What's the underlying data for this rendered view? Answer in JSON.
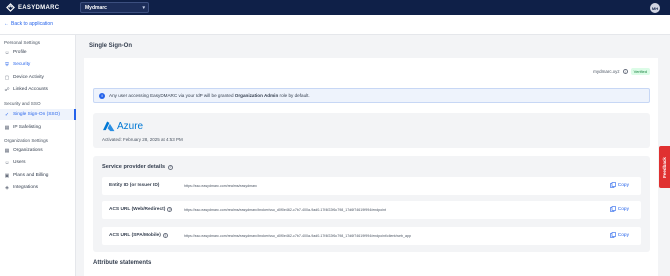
{
  "header": {
    "brand": "EASYDMARC",
    "org_name": "Mydmarc",
    "avatar_initials": "MH"
  },
  "nav": {
    "back_label": "Back to application"
  },
  "sidebar": {
    "personal_heading": "Personal Settings",
    "personal_items": [
      {
        "label": "Profile",
        "icon": "user-icon"
      },
      {
        "label": "Security",
        "icon": "shield-icon",
        "selected": true
      }
    ],
    "personal_items_2": [
      {
        "label": "Device Activity",
        "icon": "device-icon"
      },
      {
        "label": "Linked Accounts",
        "icon": "link-icon"
      }
    ],
    "security_heading": "Security and SSO",
    "security_items": [
      {
        "label": "Single Sign-On (SSO)",
        "icon": "shield-check-icon",
        "active": true
      },
      {
        "label": "IP Safelisting",
        "icon": "network-icon"
      }
    ],
    "org_heading": "Organization Settings",
    "org_items": [
      {
        "label": "Organizations",
        "icon": "building-icon"
      },
      {
        "label": "Users",
        "icon": "users-icon"
      },
      {
        "label": "Plans and Billing",
        "icon": "card-icon"
      },
      {
        "label": "Integrations",
        "icon": "puzzle-icon"
      }
    ]
  },
  "main": {
    "page_title": "Single Sign-On",
    "domain": "mydmarc.xyz",
    "verified_label": "Verified",
    "info_text_prefix": "Any user accessing EasyDMARC via your IdP will be granted ",
    "info_text_bold": "Organization Admin",
    "info_text_suffix": " role by default.",
    "provider_name": "Azure",
    "activated_text": "Activated: February 28, 2025 at 4:53 PM",
    "sp_title": "Service provider details",
    "sp_rows": [
      {
        "label": "Entity ID (or Issuer ID)",
        "value": "https://sso.easydmarc.com/realms/easydmarc",
        "copy": "Copy",
        "has_help": false
      },
      {
        "label": "ACS URL (Web/Redirect)",
        "value": "https://sso.easydmarc.com/realms/easydmarc/broker/sso_d0f0e462-c7b7-400a-9ad0-17f4f22f6c798_17d6f74619f994/endpoint",
        "copy": "Copy",
        "has_help": true
      },
      {
        "label": "ACS URL (SPA/Mobile)",
        "value": "https://sso.easydmarc.com/realms/easydmarc/broker/sso_d0f0e462-c7b7-400a-9ad0-17f4f22f6c798_17d6f74619f994/endpoint/client/web_app",
        "copy": "Copy",
        "has_help": true
      }
    ],
    "attr_title": "Attribute statements"
  },
  "feedback_label": "Feedback",
  "colors": {
    "topbar": "#0f2048",
    "accent": "#2563eb",
    "verified": "#15803d",
    "feedback": "#e03131"
  }
}
